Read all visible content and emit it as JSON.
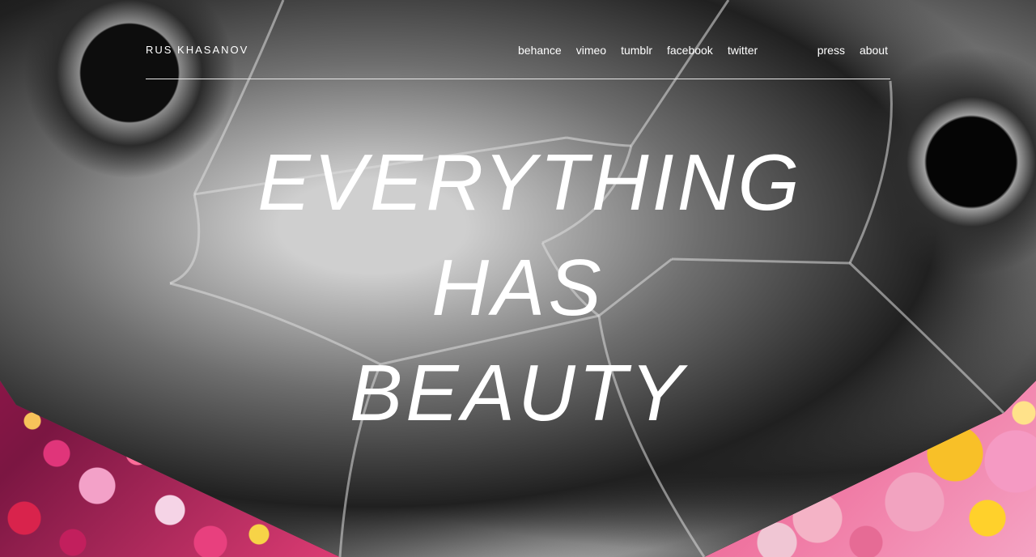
{
  "header": {
    "brand": "RUS KHASANOV",
    "nav_social": [
      {
        "label": "behance"
      },
      {
        "label": "vimeo"
      },
      {
        "label": "tumblr"
      },
      {
        "label": "facebook"
      },
      {
        "label": "twitter"
      }
    ],
    "nav_site": [
      {
        "label": "press"
      },
      {
        "label": "about"
      }
    ]
  },
  "hero": {
    "lines": [
      "EVERYTHING",
      "HAS",
      "BEAUTY"
    ]
  },
  "colors": {
    "text": "#ffffff",
    "rule": "#e6e6e6",
    "accent_pink": "#e9417a",
    "accent_yellow": "#f8c028"
  }
}
